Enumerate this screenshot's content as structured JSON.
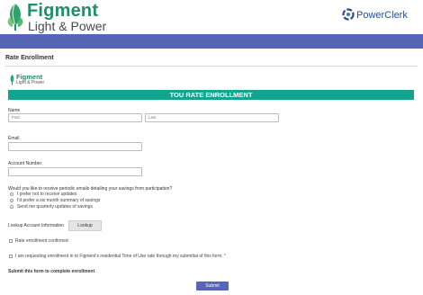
{
  "header": {
    "brand_name": "Figment",
    "brand_tagline": "Light & Power",
    "partner_name": "PowerClerk",
    "colors": {
      "brand_green": "#1f8f6a",
      "nav_bar": "#5765b8",
      "teal_banner": "#14a38e"
    }
  },
  "page": {
    "title": "Rate Enrollment"
  },
  "form": {
    "logo_name": "Figment",
    "logo_tagline": "Light & Power",
    "banner_title": "TOU RATE ENROLLMENT",
    "name_label": "Name",
    "first_placeholder": "First",
    "last_placeholder": "Last",
    "email_label": "Email",
    "email_value": "",
    "account_label": "Account Number",
    "account_value": "",
    "emails_question": "Would you like to receive periodic emails detailing your savings from participation?",
    "email_options": [
      "I prefer not to receive updates",
      "I'd prefer a six month summary of savings",
      "Send me quarterly updates of savings"
    ],
    "lookup_label": "Lookup Account Information",
    "lookup_button": "Lookup",
    "rate_confirmed_label": "Rate enrollment confirmed",
    "consent_label": "I am requesting enrollment in to Figment's residential Time of Use rate through my submittal of this form.",
    "required_mark": "*",
    "submit_heading": "Submit this form to complete enrollment",
    "submit_button": "Submit"
  }
}
